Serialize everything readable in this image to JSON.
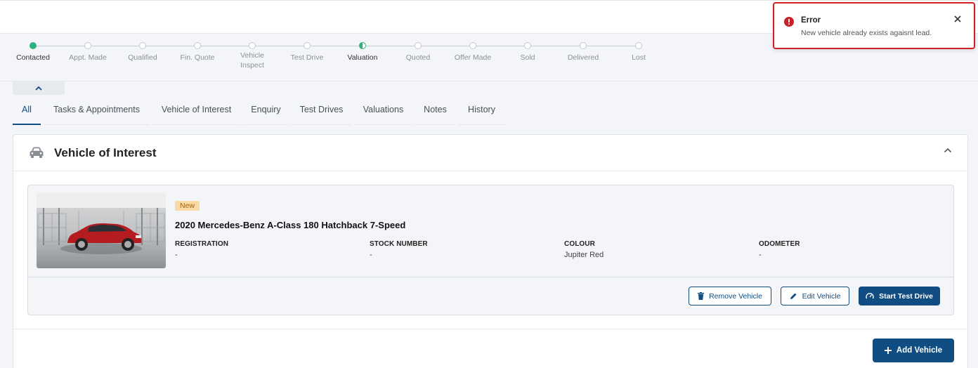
{
  "stepper": {
    "steps": [
      {
        "label": "Contacted",
        "state": "done"
      },
      {
        "label": "Appt. Made",
        "state": "todo"
      },
      {
        "label": "Qualified",
        "state": "todo"
      },
      {
        "label": "Fin. Quote",
        "state": "todo"
      },
      {
        "label": "Vehicle\nInspect",
        "state": "todo"
      },
      {
        "label": "Test Drive",
        "state": "todo"
      },
      {
        "label": "Valuation",
        "state": "current"
      },
      {
        "label": "Quoted",
        "state": "todo"
      },
      {
        "label": "Offer Made",
        "state": "todo"
      },
      {
        "label": "Sold",
        "state": "todo"
      },
      {
        "label": "Delivered",
        "state": "todo"
      },
      {
        "label": "Lost",
        "state": "todo"
      }
    ]
  },
  "tabs": [
    {
      "label": "All",
      "active": true
    },
    {
      "label": "Tasks & Appointments"
    },
    {
      "label": "Vehicle of Interest"
    },
    {
      "label": "Enquiry"
    },
    {
      "label": "Test Drives"
    },
    {
      "label": "Valuations"
    },
    {
      "label": "Notes"
    },
    {
      "label": "History"
    }
  ],
  "section": {
    "title": "Vehicle of Interest",
    "icon": "car-icon"
  },
  "vehicle": {
    "badge": "New",
    "name": "2020 Mercedes-Benz A-Class 180 Hatchback 7-Speed",
    "fields": [
      {
        "key": "REGISTRATION",
        "value": "-"
      },
      {
        "key": "STOCK NUMBER",
        "value": "-"
      },
      {
        "key": "COLOUR",
        "value": "Jupiter Red"
      },
      {
        "key": "ODOMETER",
        "value": "-"
      }
    ],
    "remove_label": "Remove Vehicle",
    "edit_label": "Edit Vehicle",
    "start_label": "Start Test Drive"
  },
  "add_vehicle_label": "Add Vehicle",
  "toast": {
    "title": "Error",
    "message": "New vehicle already exists agaisnt lead."
  },
  "colors": {
    "accent": "#0f4d82",
    "success": "#2fb37c",
    "error": "#d11f28",
    "badge_bg": "#fbd9a4"
  }
}
